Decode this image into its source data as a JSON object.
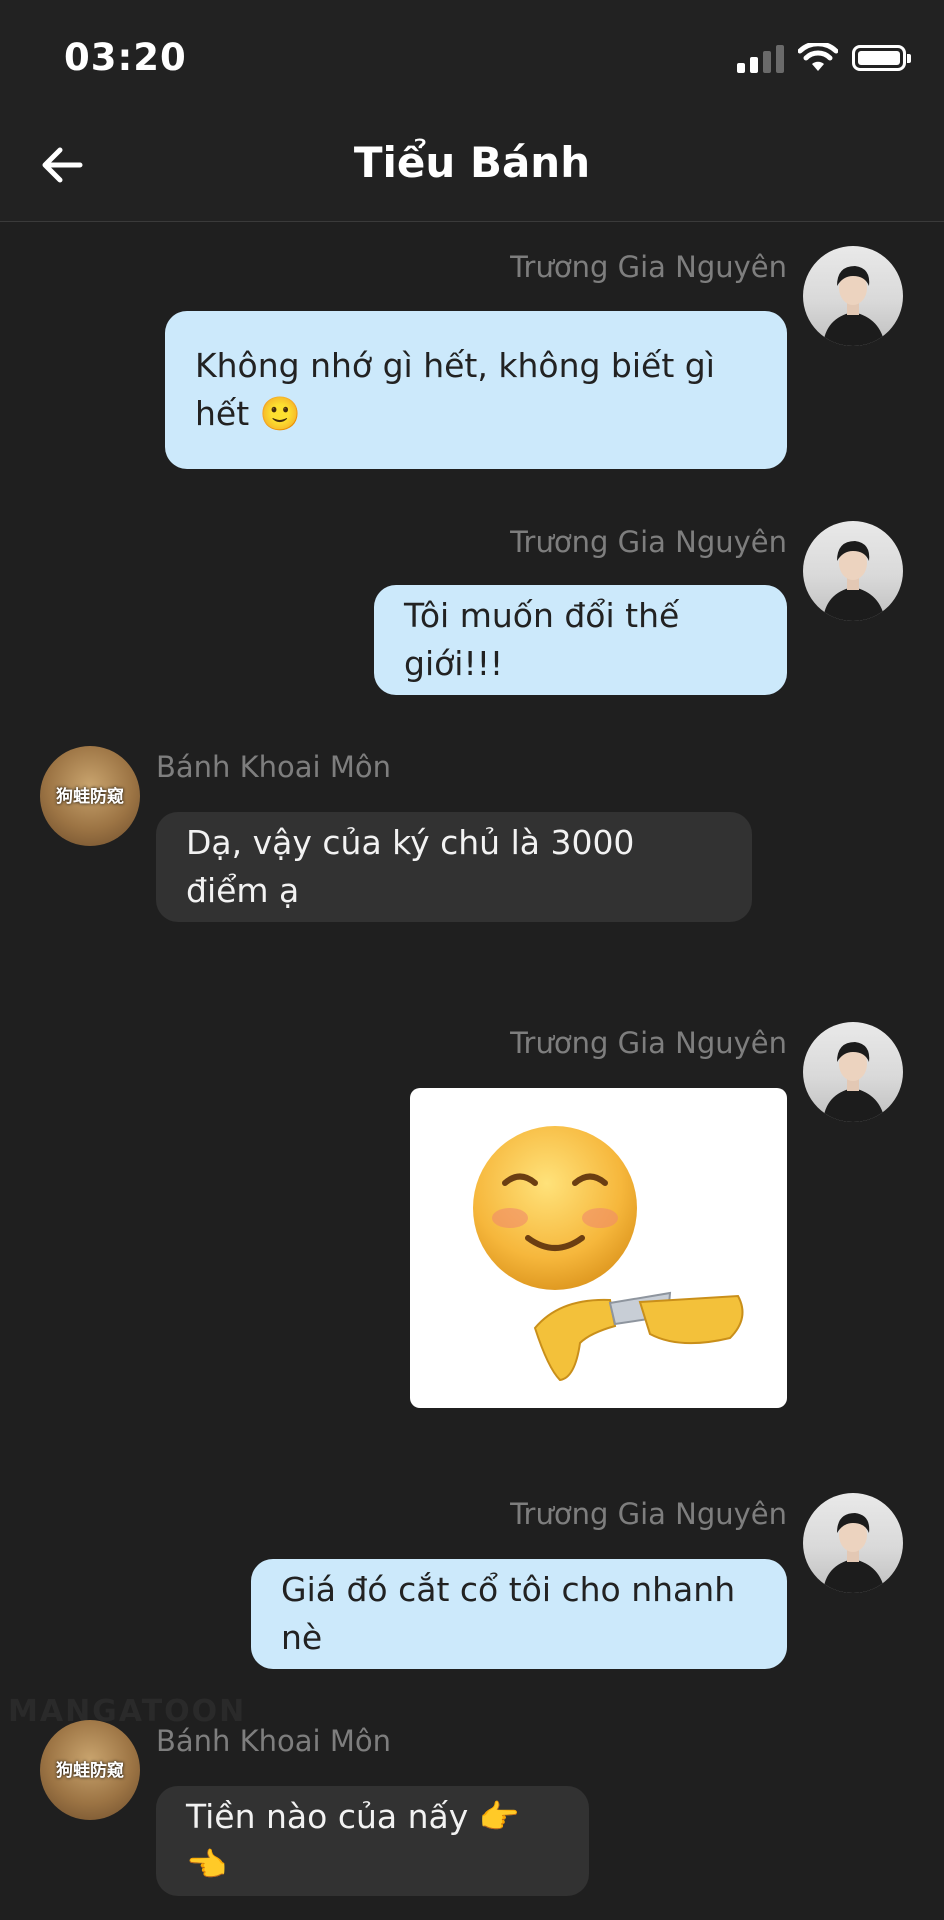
{
  "status_bar": {
    "time": "03:20"
  },
  "header": {
    "title": "Tiểu Bánh"
  },
  "messages": [
    {
      "side": "right",
      "sender": "Trương Gia Nguyên",
      "text": "Không nhớ gì hết, không biết gì hết 🙂"
    },
    {
      "side": "right",
      "sender": "Trương Gia Nguyên",
      "text": "Tôi muốn đổi thế giới!!!"
    },
    {
      "side": "left",
      "sender": "Bánh Khoai Môn",
      "text": "Dạ, vậy của ký chủ là 3000 điểm ạ",
      "avatar_text": "狗蛙防窥"
    },
    {
      "side": "right",
      "sender": "Trương Gia Nguyên",
      "sticker": "smiling-face-knife-sticker"
    },
    {
      "side": "right",
      "sender": "Trương Gia Nguyên",
      "text": "Giá đó cắt cổ tôi cho nhanh nè"
    },
    {
      "side": "left",
      "sender": "Bánh Khoai Môn",
      "text": "Tiền nào của nấy 👉👈",
      "avatar_text": "狗蛙防窥"
    }
  ],
  "watermark": "MANGATOON",
  "colors": {
    "background": "#1f1f1f",
    "bubble_right": "#cce9fb",
    "bubble_left": "#323232"
  }
}
